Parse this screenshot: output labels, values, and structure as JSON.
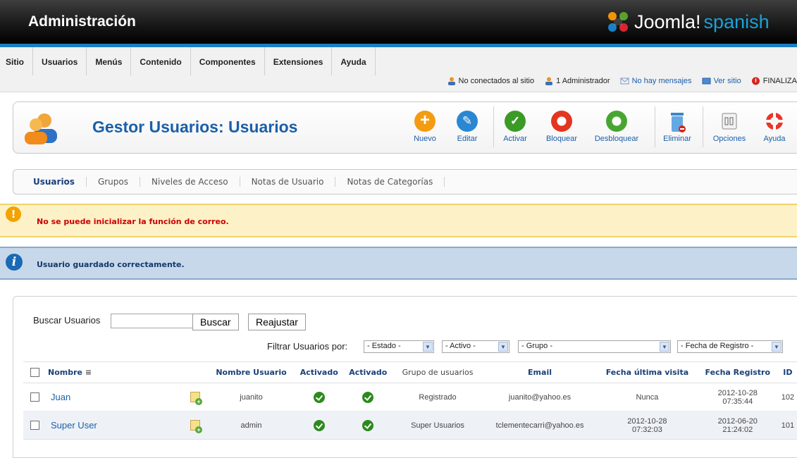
{
  "header": {
    "title": "Administración",
    "logo_main": "Joomla!",
    "logo_suffix": "spanish"
  },
  "menu": {
    "items": [
      "Sitio",
      "Usuarios",
      "Menús",
      "Contenido",
      "Componentes",
      "Extensiones",
      "Ayuda"
    ]
  },
  "status": {
    "not_connected": "No conectados al sitio",
    "admins": "1 Administrador",
    "messages": "No hay mensajes",
    "view_site": "Ver sitio",
    "logout": "FINALIZA"
  },
  "toolbar": {
    "title": "Gestor Usuarios: Usuarios",
    "new": "Nuevo",
    "edit": "Editar",
    "activate": "Activar",
    "block": "Bloquear",
    "unblock": "Desbloquear",
    "delete": "Eliminar",
    "options": "Opciones",
    "help": "Ayuda"
  },
  "subtabs": [
    "Usuarios",
    "Grupos",
    "Niveles de Acceso",
    "Notas de Usuario",
    "Notas de Categorías"
  ],
  "messages": {
    "warning": "No se puede inicializar la función de correo.",
    "info": "Usuario guardado correctamente."
  },
  "search": {
    "label": "Buscar Usuarios",
    "value": "",
    "search_button": "Buscar",
    "reset_button": "Reajustar"
  },
  "filters": {
    "label": "Filtrar Usuarios por:",
    "state": "- Estado -",
    "active": "- Activo -",
    "group": "- Grupo -",
    "registration_date": "- Fecha de Registro -"
  },
  "table": {
    "headers": {
      "name": "Nombre",
      "username": "Nombre Usuario",
      "enabled": "Activado",
      "activated": "Activado",
      "groups": "Grupo de usuarios",
      "email": "Email",
      "last_visit": "Fecha última visita",
      "registered": "Fecha Registro",
      "id": "ID"
    },
    "rows": [
      {
        "name": "Juan",
        "username": "juanito",
        "group": "Registrado",
        "email": "juanito@yahoo.es",
        "last_visit": "Nunca",
        "last_visit_time": "",
        "registered_date": "2012-10-28",
        "registered_time": "07:35:44",
        "id": "102"
      },
      {
        "name": "Super User",
        "username": "admin",
        "group": "Super Usuarios",
        "email": "tclementecarri@yahoo.es",
        "last_visit": "2012-10-28",
        "last_visit_time": "07:32:03",
        "registered_date": "2012-06-20",
        "registered_time": "21:24:02",
        "id": "101"
      }
    ]
  }
}
